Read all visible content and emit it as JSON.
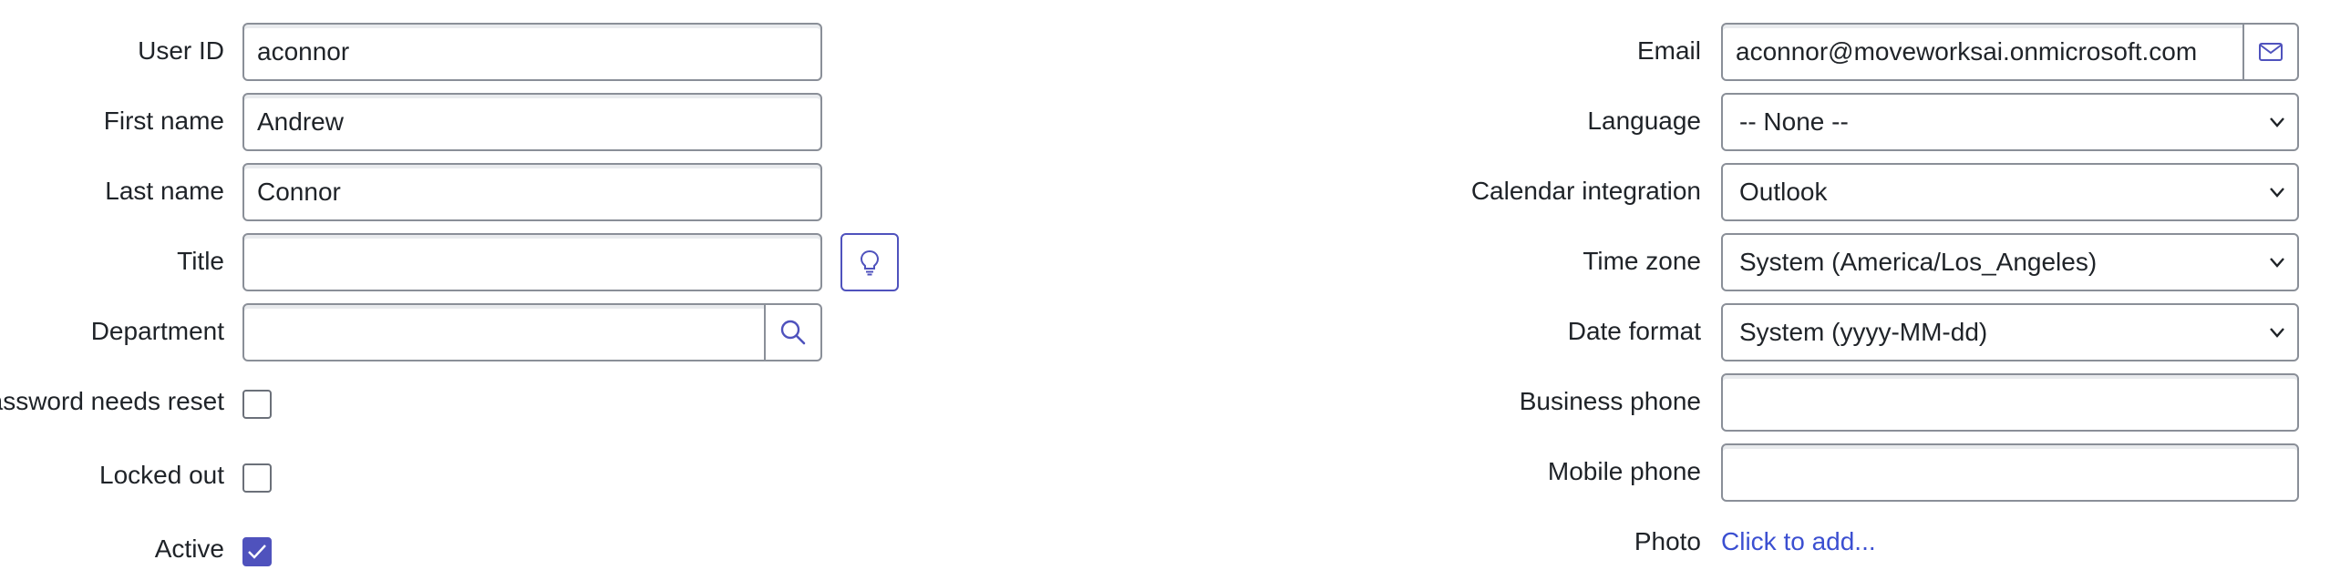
{
  "left_form": {
    "user_id": {
      "label": "User ID",
      "value": "aconnor"
    },
    "first_name": {
      "label": "First name",
      "value": "Andrew"
    },
    "last_name": {
      "label": "Last name",
      "value": "Connor"
    },
    "title": {
      "label": "Title",
      "value": "",
      "suggest_icon": "lightbulb-icon"
    },
    "department": {
      "label": "Department",
      "value": "",
      "lookup_icon": "search-icon"
    },
    "password_needs_reset": {
      "label": "Password needs reset",
      "checked": false
    },
    "locked_out": {
      "label": "Locked out",
      "checked": false
    },
    "active": {
      "label": "Active",
      "checked": true
    }
  },
  "right_form": {
    "email": {
      "label": "Email",
      "value": "aconnor@moveworksai.onmicrosoft.com",
      "action_icon": "mail-icon"
    },
    "language": {
      "label": "Language",
      "selected": "-- None --"
    },
    "calendar_integration": {
      "label": "Calendar integration",
      "selected": "Outlook"
    },
    "time_zone": {
      "label": "Time zone",
      "selected": "System (America/Los_Angeles)"
    },
    "date_format": {
      "label": "Date format",
      "selected": "System (yyyy-MM-dd)"
    },
    "business_phone": {
      "label": "Business phone",
      "value": ""
    },
    "mobile_phone": {
      "label": "Mobile phone",
      "value": ""
    },
    "photo": {
      "label": "Photo",
      "link_text": "Click to add..."
    }
  },
  "colors": {
    "accent": "#4f52bd",
    "link": "#3b4fd1",
    "border": "#8a8f98"
  }
}
